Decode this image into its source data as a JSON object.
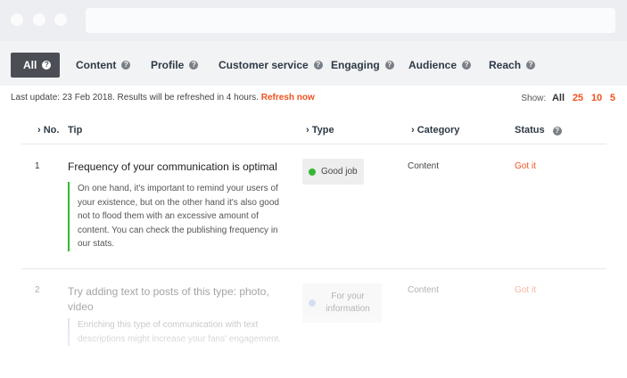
{
  "tabs": [
    {
      "label": "All"
    },
    {
      "label": "Content"
    },
    {
      "label": "Profile"
    },
    {
      "label": "Customer service"
    },
    {
      "label": "Engaging"
    },
    {
      "label": "Audience"
    },
    {
      "label": "Reach"
    }
  ],
  "info": {
    "last_update": "Last update: 23 Feb 2018. Results will be refreshed in 4 hours.",
    "refresh_label": "Refresh now",
    "show_label": "Show:",
    "show_options": [
      "All",
      "25",
      "10",
      "5"
    ]
  },
  "columns": {
    "no": "No.",
    "tip": "Tip",
    "type": "Type",
    "category": "Category",
    "status": "Status"
  },
  "rows": [
    {
      "no": "1",
      "title": "Frequency of your communication is optimal",
      "description": "On one hand, it's important to remind your users of your existence, but on the other hand it's also good not to flood them with an excessive amount of content. You can check the publishing frequency in our stats.",
      "type": "Good job",
      "category": "Content",
      "status": "Got it"
    },
    {
      "no": "2",
      "title": "Try adding text to posts of this type: photo, video",
      "description": "Enriching this type of communication with text descriptions might increase your fans' engagement.",
      "type": "For your information",
      "category": "Content",
      "status": "Got it"
    }
  ],
  "colors": {
    "accent": "#f0521f",
    "good_job": "#35b835",
    "info": "#9aaedc"
  }
}
